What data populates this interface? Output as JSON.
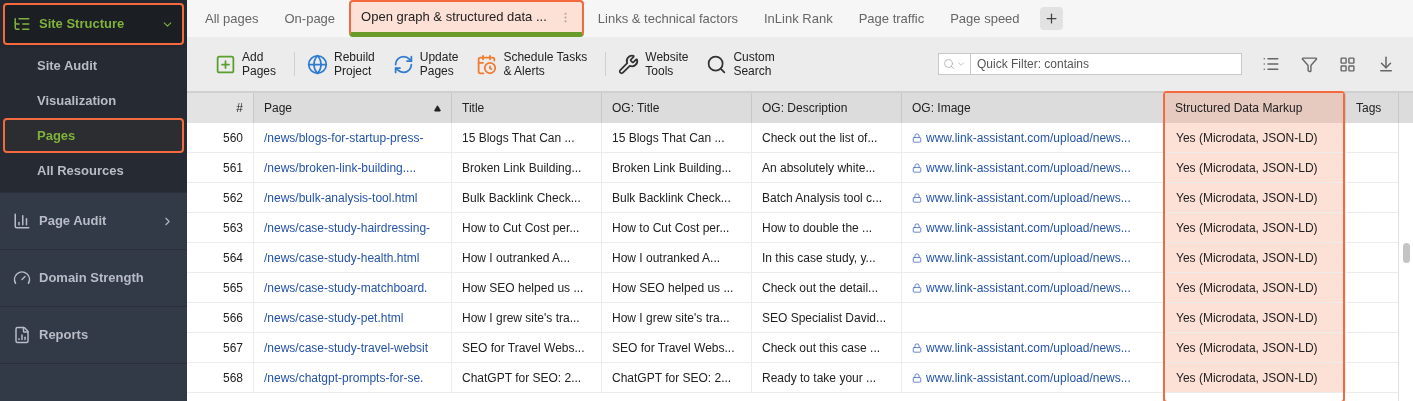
{
  "sidebar": {
    "sections": [
      {
        "kind": "tree",
        "label": "Site Structure",
        "expanded": true,
        "selected": true,
        "highlighted": true,
        "children": [
          {
            "label": "Site Audit",
            "selected": false,
            "highlighted": false
          },
          {
            "label": "Visualization",
            "selected": false,
            "highlighted": false
          },
          {
            "label": "Pages",
            "selected": true,
            "highlighted": true
          },
          {
            "label": "All Resources",
            "selected": false,
            "highlighted": false
          }
        ]
      },
      {
        "kind": "audit",
        "label": "Page Audit",
        "expanded": false,
        "selected": false,
        "highlighted": false
      },
      {
        "kind": "gauge",
        "label": "Domain Strength",
        "selected": false,
        "highlighted": false
      },
      {
        "kind": "reports",
        "label": "Reports",
        "selected": false,
        "highlighted": false
      }
    ]
  },
  "tabs": [
    {
      "label": "All pages",
      "selected": false,
      "highlighted": false
    },
    {
      "label": "On-page",
      "selected": false,
      "highlighted": false
    },
    {
      "label": "Open graph & structured data ...",
      "selected": true,
      "highlighted": true
    },
    {
      "label": "Links & technical factors",
      "selected": false,
      "highlighted": false
    },
    {
      "label": "InLink Rank",
      "selected": false,
      "highlighted": false
    },
    {
      "label": "Page traffic",
      "selected": false,
      "highlighted": false
    },
    {
      "label": "Page speed",
      "selected": false,
      "highlighted": false
    }
  ],
  "toolbar": {
    "buttons": [
      {
        "kind": "add",
        "lines": [
          "Add",
          "Pages"
        ]
      },
      {
        "kind": "rebuild",
        "lines": [
          "Rebuild",
          "Project"
        ]
      },
      {
        "kind": "update",
        "lines": [
          "Update",
          "Pages"
        ]
      },
      {
        "kind": "schedule",
        "lines": [
          "Schedule Tasks",
          "& Alerts"
        ]
      },
      {
        "kind": "tools",
        "lines": [
          "Website",
          "Tools"
        ]
      },
      {
        "kind": "search",
        "lines": [
          "Custom",
          "Search"
        ]
      }
    ],
    "filter": {
      "placeholder": "Quick Filter: contains"
    }
  },
  "table": {
    "columns": [
      {
        "kind": "number",
        "label": "#",
        "highlighted": false
      },
      {
        "kind": "link",
        "label": "Page",
        "highlighted": false,
        "sorted": true
      },
      {
        "kind": "text",
        "label": "Title",
        "highlighted": false
      },
      {
        "kind": "text",
        "label": "OG: Title",
        "highlighted": false
      },
      {
        "kind": "text",
        "label": "OG: Description",
        "highlighted": false
      },
      {
        "kind": "image_link",
        "label": "OG: Image",
        "highlighted": false
      },
      {
        "kind": "text",
        "label": "Structured Data Markup",
        "highlighted": true
      },
      {
        "kind": "text",
        "label": "Tags",
        "highlighted": false
      }
    ],
    "rows": [
      {
        "num": "560",
        "page": "/news/blogs-for-startup-press-",
        "title": "15 Blogs That Can ...",
        "og_title": "15 Blogs That Can ...",
        "og_description": "Check out the list of...",
        "og_image": "www.link-assistant.com/upload/news...",
        "structured": "Yes (Microdata, JSON-LD)"
      },
      {
        "num": "561",
        "page": "/news/broken-link-building....",
        "title": "Broken Link Building...",
        "og_title": "Broken Link Building...",
        "og_description": "An absolutely white...",
        "og_image": "www.link-assistant.com/upload/news...",
        "structured": "Yes (Microdata, JSON-LD)"
      },
      {
        "num": "562",
        "page": "/news/bulk-analysis-tool.html",
        "title": "Bulk Backlink Check...",
        "og_title": "Bulk Backlink Check...",
        "og_description": "Batch Analysis tool c...",
        "og_image": "www.link-assistant.com/upload/news...",
        "structured": "Yes (Microdata, JSON-LD)"
      },
      {
        "num": "563",
        "page": "/news/case-study-hairdressing-",
        "title": "How to Cut Cost per...",
        "og_title": "How to Cut Cost per...",
        "og_description": "How to double the ...",
        "og_image": "www.link-assistant.com/upload/news...",
        "structured": "Yes (Microdata, JSON-LD)"
      },
      {
        "num": "564",
        "page": "/news/case-study-health.html",
        "title": "How I outranked A...",
        "og_title": "How I outranked A...",
        "og_description": "In this case study, y...",
        "og_image": "www.link-assistant.com/upload/news...",
        "structured": "Yes (Microdata, JSON-LD)"
      },
      {
        "num": "565",
        "page": "/news/case-study-matchboard.",
        "title": "How SEO helped us ...",
        "og_title": "How SEO helped us ...",
        "og_description": "Check out the detail...",
        "og_image": "www.link-assistant.com/upload/news...",
        "structured": "Yes (Microdata, JSON-LD)"
      },
      {
        "num": "566",
        "page": "/news/case-study-pet.html",
        "title": "How I grew site's tra...",
        "og_title": "How I grew site's tra...",
        "og_description": "SEO Specialist David...",
        "structured": "Yes (Microdata, JSON-LD)"
      },
      {
        "num": "567",
        "page": "/news/case-study-travel-websit",
        "title": "SEO for Travel Webs...",
        "og_title": "SEO for Travel Webs...",
        "og_description": "Check out this case ...",
        "og_image": "www.link-assistant.com/upload/news...",
        "structured": "Yes (Microdata, JSON-LD)"
      },
      {
        "num": "568",
        "page": "/news/chatgpt-prompts-for-se.",
        "title": "ChatGPT for SEO: 2...",
        "og_title": "ChatGPT for SEO: 2...",
        "og_description": "Ready to take your ...",
        "og_image": "www.link-assistant.com/upload/news...",
        "structured": "Yes (Microdata, JSON-LD)"
      }
    ]
  }
}
